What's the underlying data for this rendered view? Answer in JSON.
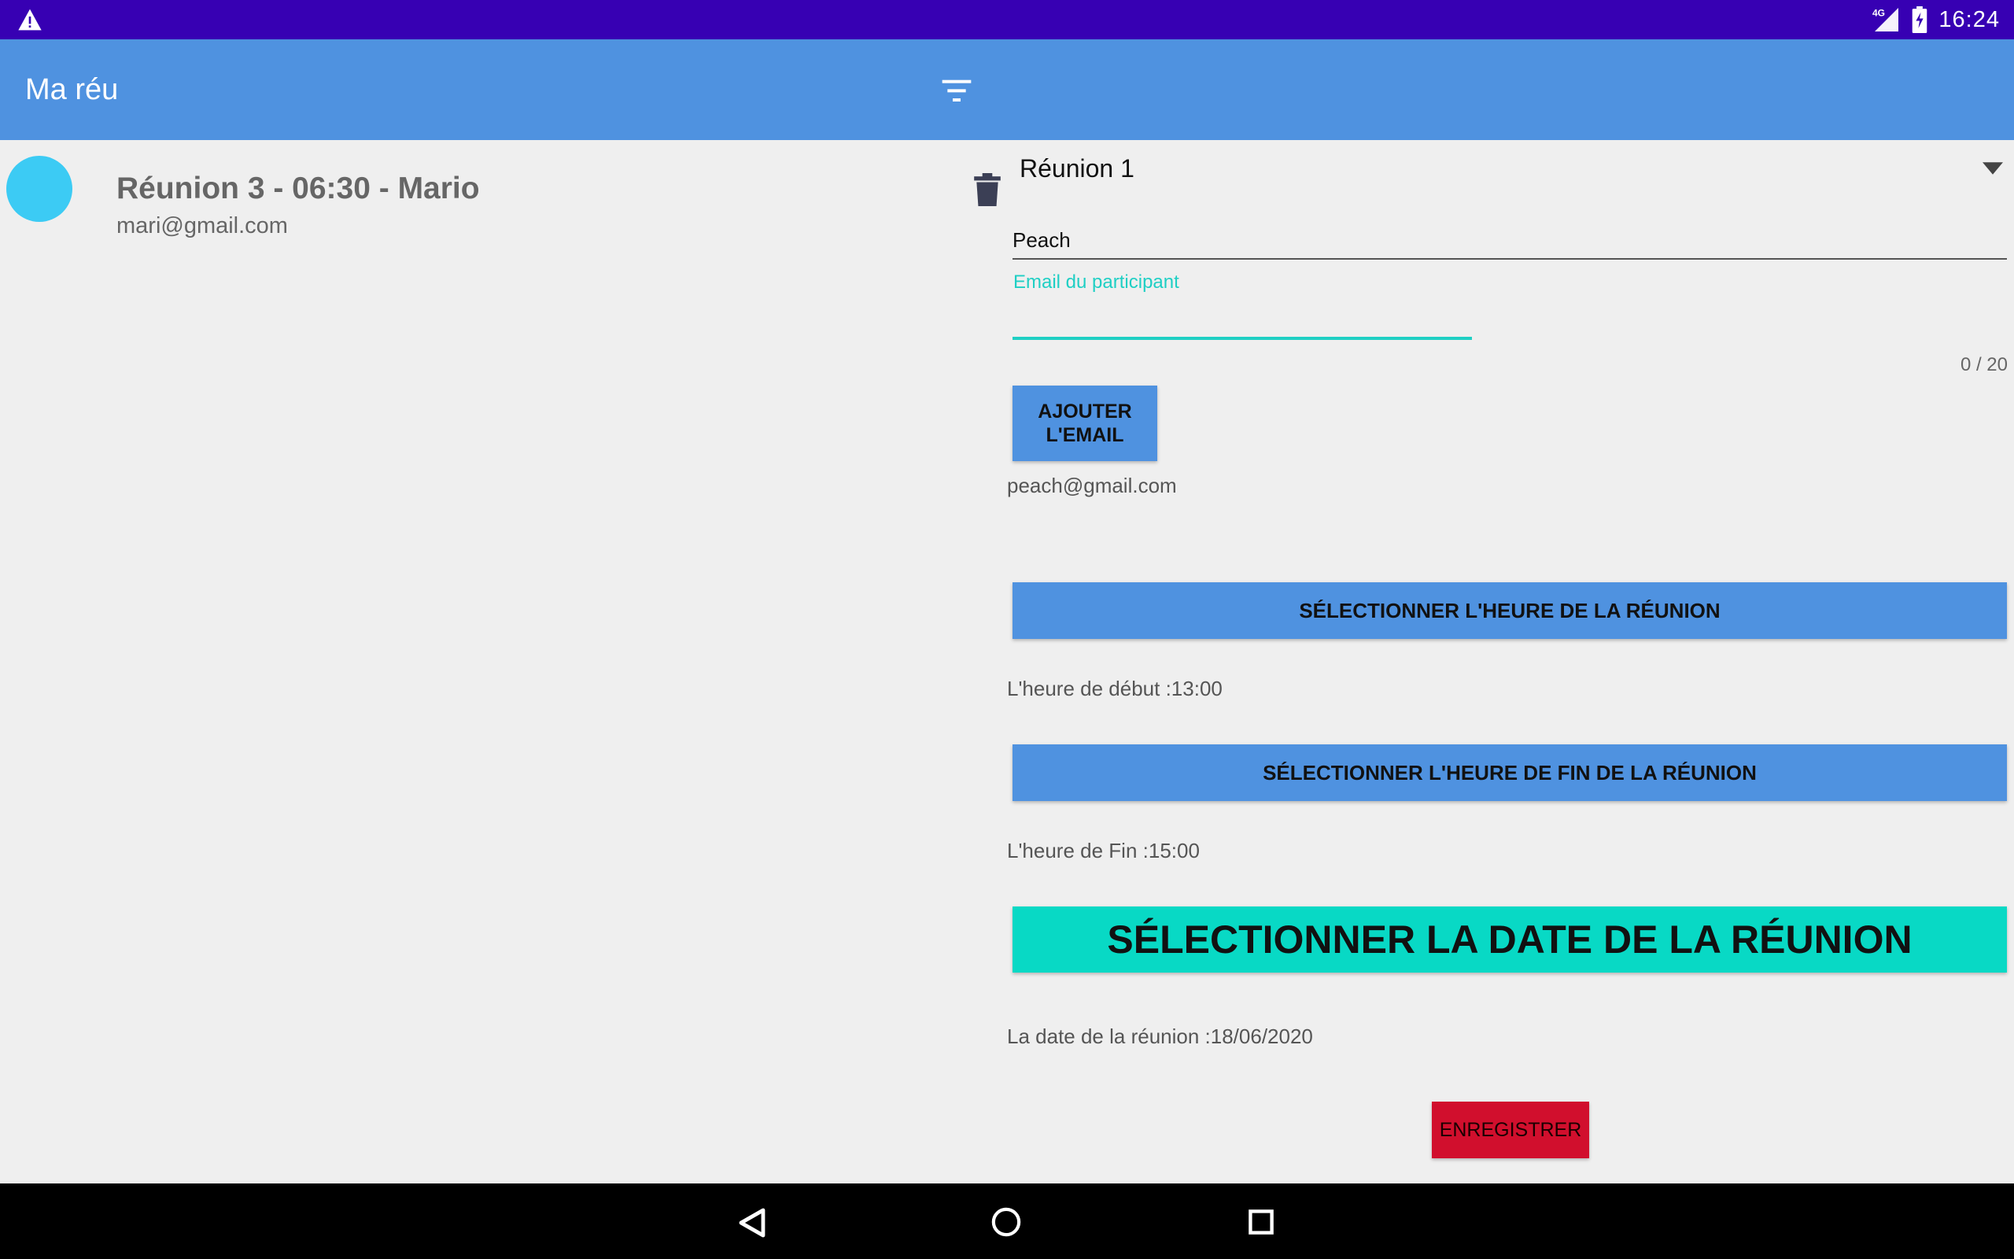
{
  "status_bar": {
    "time": "16:24",
    "network": "4G",
    "icons": [
      "warning-icon",
      "signal-icon",
      "battery-charging-icon"
    ]
  },
  "app_bar": {
    "title": "Ma réu",
    "filter_icon": "filter-icon"
  },
  "meetings": [
    {
      "title": "Réunion 3 - 06:30 - Mario",
      "email": "mari@gmail.com",
      "avatar_color": "#3ccbf4"
    }
  ],
  "form": {
    "room_selected": "Réunion 1",
    "name_value": "Peach",
    "email_label": "Email du participant",
    "email_value": "",
    "email_counter": "0 / 20",
    "add_email_label": "AJOUTER L'EMAIL",
    "added_email": "peach@gmail.com",
    "select_start_label": "SÉLECTIONNER L'HEURE DE LA RÉUNION",
    "start_text": "L'heure de début :13:00",
    "select_end_label": "SÉLECTIONNER L'HEURE DE FIN DE LA RÉUNION",
    "end_text": "L'heure de Fin :15:00",
    "select_date_label": "SÉLECTIONNER LA DATE DE LA RÉUNION",
    "date_text": "La date de la réunion :18/06/2020",
    "save_label": "ENREGISTRER"
  },
  "colors": {
    "status_bar": "#3700b3",
    "primary": "#4f92e0",
    "accent": "#08d9c5",
    "save": "#d10f2d",
    "background": "#efefef"
  },
  "nav_bar": {
    "icons": [
      "back-icon",
      "home-icon",
      "recents-icon"
    ]
  }
}
